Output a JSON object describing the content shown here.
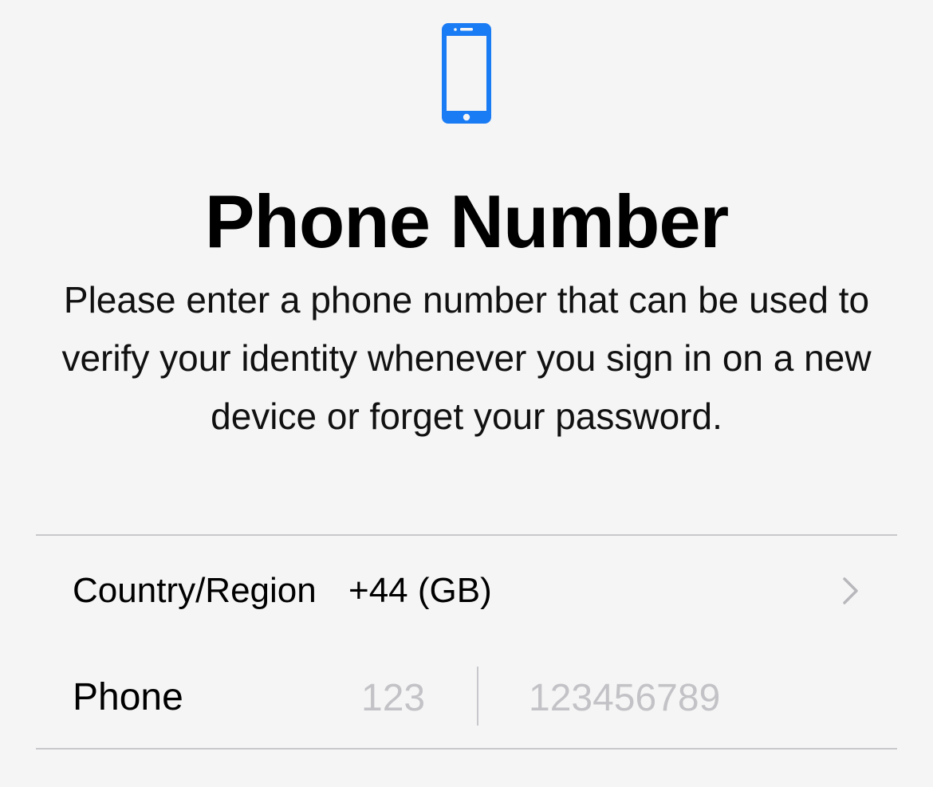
{
  "header": {
    "icon": "iphone-icon",
    "title": "Phone Number",
    "description": "Please enter a phone number that can be used to verify your identity whenever you sign in on a new device or forget your password."
  },
  "form": {
    "country": {
      "label": "Country/Region",
      "value": "+44 (GB)",
      "icon": "chevron-right-icon"
    },
    "phone": {
      "label": "Phone",
      "code_placeholder": "123",
      "number_placeholder": "123456789"
    }
  },
  "colors": {
    "accent": "#1a7cf5",
    "background": "#f5f5f5",
    "separator": "#c8c8cc",
    "placeholder": "#c3c3c7",
    "chevron": "#b8b8bc"
  }
}
